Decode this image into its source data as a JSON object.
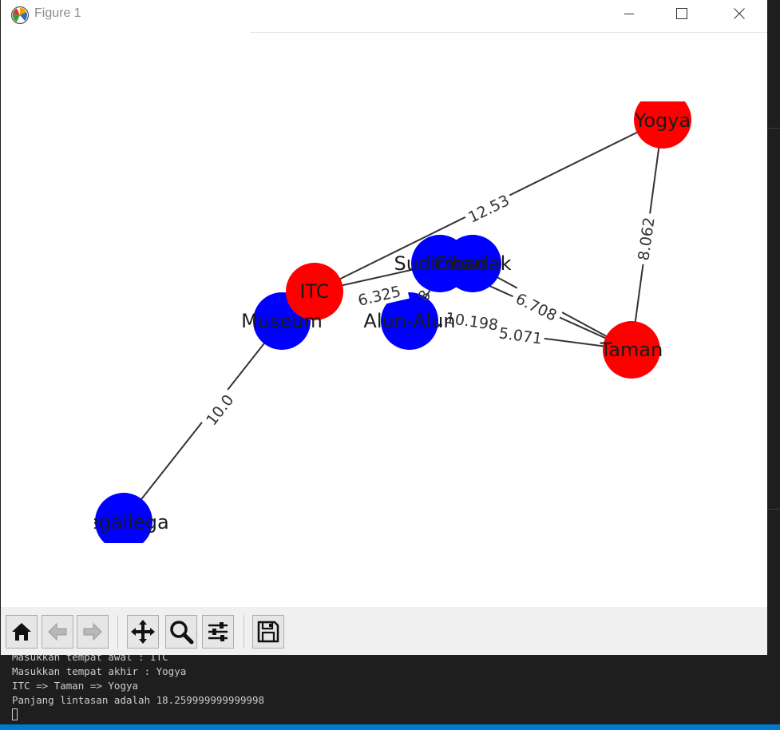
{
  "window": {
    "title": "Figure 1"
  },
  "icons": {
    "app": "matplotlib-logo-icon",
    "minimize": "minimize-icon",
    "maximize": "maximize-icon",
    "close": "close-icon",
    "home": "home-icon",
    "back": "arrow-left-icon",
    "forward": "arrow-right-icon",
    "pan": "move-arrows-icon",
    "zoom": "magnifier-icon",
    "configure": "sliders-icon",
    "save": "floppy-disk-icon"
  },
  "colors": {
    "node_red": "#ff0000",
    "node_blue": "#0000ff",
    "edge": "#333333",
    "terminal_bg": "#1e1e1e",
    "status_bar": "#007acc"
  },
  "graph": {
    "nodes": [
      {
        "label": "Yogya",
        "color": "red"
      },
      {
        "label": "ITC",
        "color": "red"
      },
      {
        "label": "Taman",
        "color": "red"
      },
      {
        "label": "Museum",
        "color": "blue"
      },
      {
        "label": "Sudirman",
        "color": "blue"
      },
      {
        "label": "Cibadak",
        "color": "blue"
      },
      {
        "label": "Alun-Alun",
        "color": "blue"
      },
      {
        "label": "Tegallega",
        "color": "blue"
      }
    ],
    "edge_labels": {
      "itc_yogya": "12.53",
      "yogya_taman": "8.062",
      "itc_sudirman": "6.325",
      "cibadak_taman": "6.708",
      "alun_taman": "10.198",
      "sudirman_taman": "5.071",
      "museum_tegallega": "10.0",
      "hidden_mid": "8"
    }
  },
  "terminal": {
    "lines": [
      "Masukkan tempat awal : ITC",
      "Masukkan tempat akhir : Yogya",
      "ITC => Taman => Yogya",
      "Panjang lintasan adalah 18.259999999999998"
    ]
  }
}
